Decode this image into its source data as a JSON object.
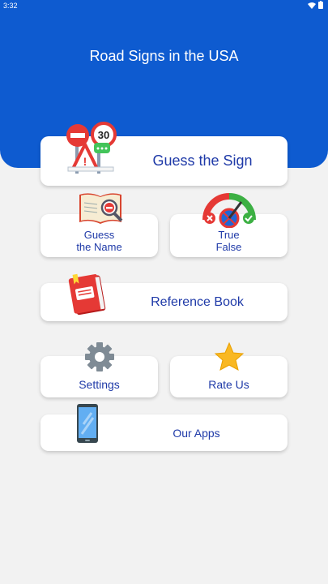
{
  "status_bar": {
    "time": "3:32"
  },
  "header": {
    "title": "Road Signs in the USA"
  },
  "menu": {
    "guess_sign": "Guess the Sign",
    "guess_name_line1": "Guess",
    "guess_name_line2": "the Name",
    "true_false_line1": "True",
    "true_false_line2": "False",
    "reference_book": "Reference Book",
    "settings": "Settings",
    "rate_us": "Rate Us",
    "our_apps": "Our Apps"
  },
  "signs": {
    "speed_limit": "30"
  },
  "icons": [
    "wifi-icon",
    "battery-icon",
    "road-signs-icon",
    "open-book-magnifier-icon",
    "gauge-icon",
    "red-book-icon",
    "gear-icon",
    "star-icon",
    "phone-icon"
  ],
  "colors": {
    "header": "#0e5bd0",
    "card_text": "#1f3aa8",
    "background": "#f2f2f2"
  }
}
